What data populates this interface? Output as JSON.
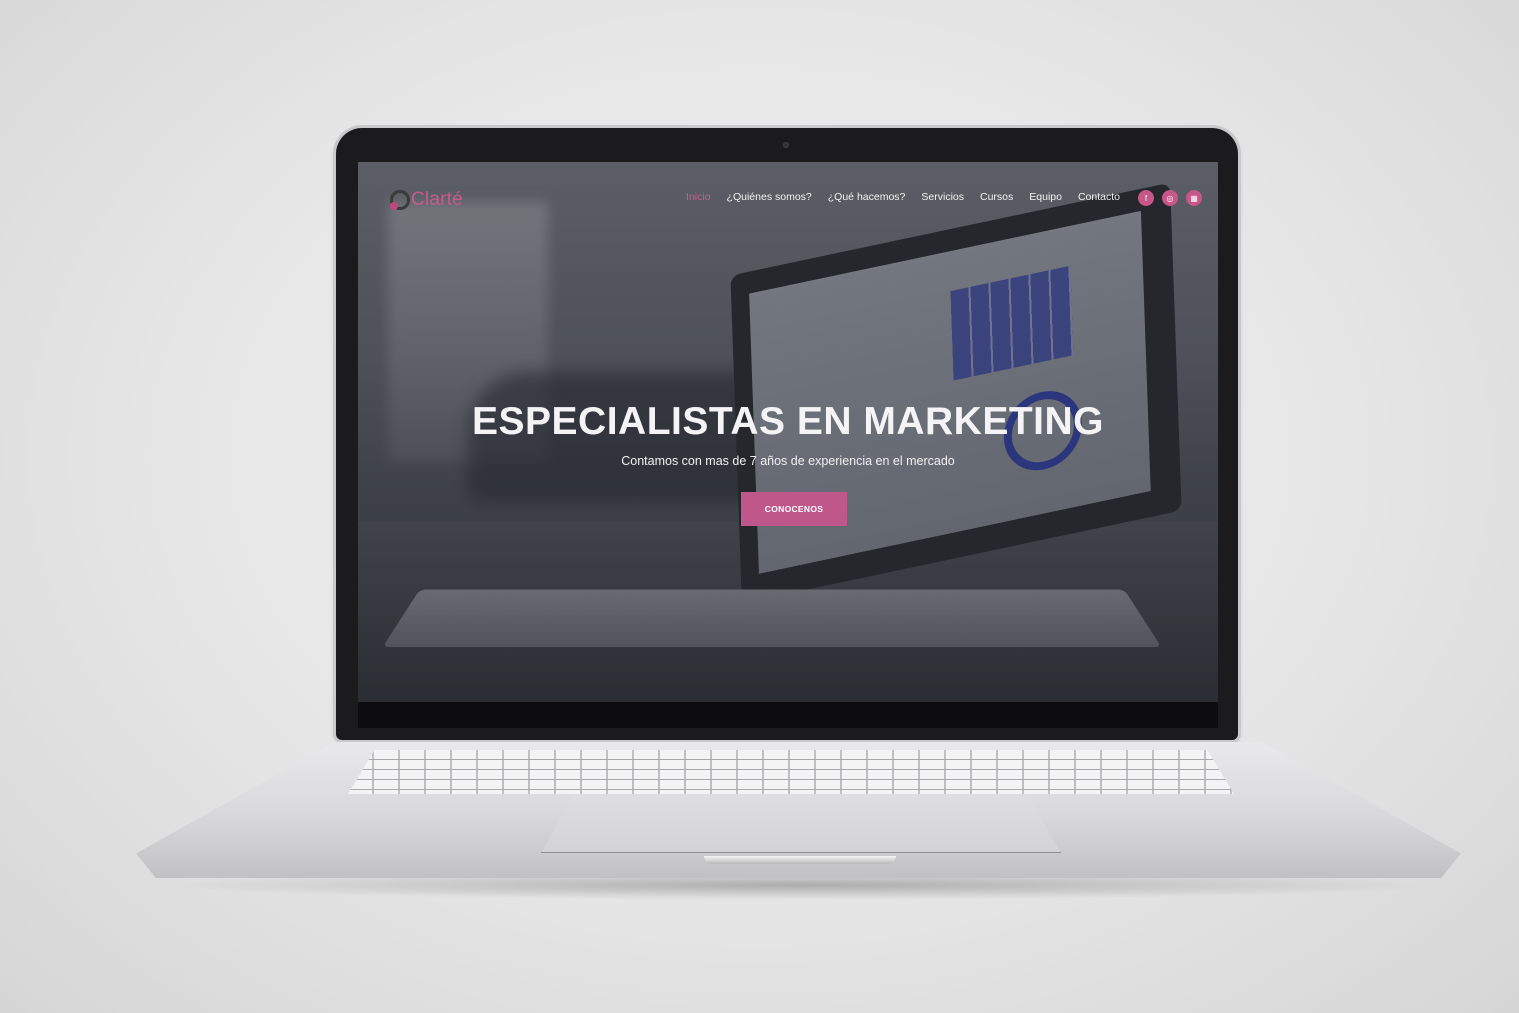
{
  "site": {
    "logo_text": "Clarté",
    "nav": [
      {
        "label": "Inicio",
        "active": true
      },
      {
        "label": "¿Quiénes somos?",
        "active": false
      },
      {
        "label": "¿Qué hacemos?",
        "active": false
      },
      {
        "label": "Servicios",
        "active": false
      },
      {
        "label": "Cursos",
        "active": false
      },
      {
        "label": "Equipo",
        "active": false
      },
      {
        "label": "Contacto",
        "active": false
      }
    ],
    "social_icons": [
      "facebook-icon",
      "instagram-icon",
      "linkedin-icon"
    ],
    "social_glyphs": [
      "f",
      "◎",
      "▦"
    ]
  },
  "hero": {
    "title": "ESPECIALISTAS EN MARKETING",
    "subtitle": "Contamos con mas de 7 años de experiencia en el mercado",
    "button_label": "CONOCENOS"
  },
  "colors": {
    "accent": "#c0578b",
    "background": "#e6e6e6"
  }
}
